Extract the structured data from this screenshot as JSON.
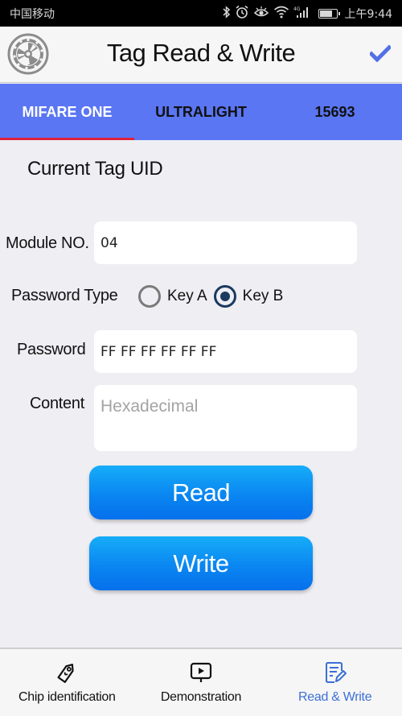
{
  "status_bar": {
    "carrier": "中国移动",
    "network": "4G",
    "battery_level": 0.8,
    "time": "上午9:44",
    "icons": [
      "bluetooth-icon",
      "alarm-icon",
      "eye-care-icon",
      "wifi-icon",
      "signal-icon",
      "battery-icon"
    ]
  },
  "header": {
    "title": "Tag Read & Write",
    "left_icon": "settings-gear-icon",
    "right_icon": "checkmark-icon",
    "accent_color": "#5a76f3"
  },
  "tabs": [
    {
      "label": "MIFARE ONE",
      "active": true
    },
    {
      "label": "ULTRALIGHT",
      "active": false
    },
    {
      "label": "15693",
      "active": false
    }
  ],
  "form": {
    "uid_label": "Current Tag UID",
    "module_label": "Module NO.",
    "module_value": "04",
    "password_type_label": "Password Type",
    "password_type_options": [
      {
        "label": "Key A",
        "checked": false
      },
      {
        "label": "Key B",
        "checked": true
      }
    ],
    "password_label": "Password",
    "password_value": "FF FF FF FF FF FF",
    "content_label": "Content",
    "content_placeholder": "Hexadecimal",
    "content_value": ""
  },
  "buttons": {
    "read": "Read",
    "write": "Write"
  },
  "bottom_nav": [
    {
      "label": "Chip identification",
      "icon": "tag-icon",
      "active": false
    },
    {
      "label": "Demonstration",
      "icon": "video-play-icon",
      "active": false
    },
    {
      "label": "Read & Write",
      "icon": "edit-document-icon",
      "active": true
    }
  ]
}
